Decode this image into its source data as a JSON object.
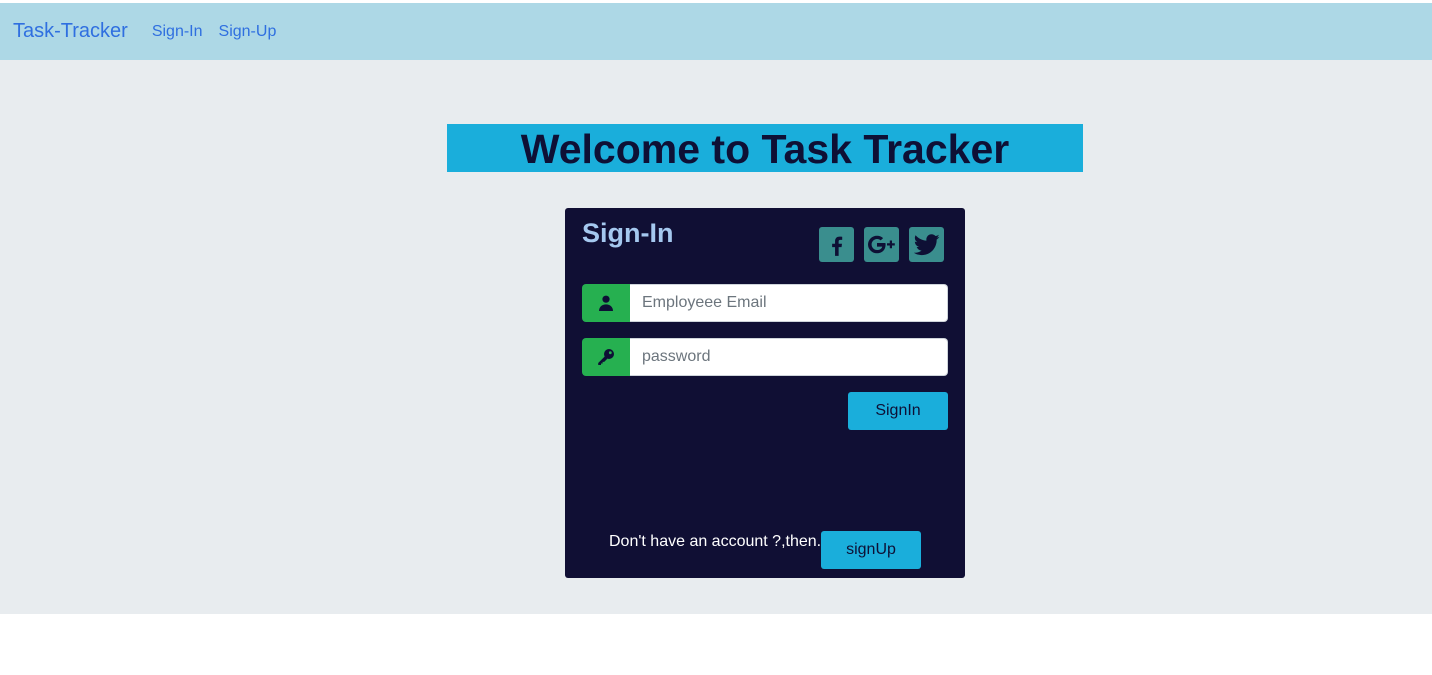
{
  "navbar": {
    "brand": "Task-Tracker",
    "links": [
      "Sign-In",
      "Sign-Up"
    ]
  },
  "welcome": {
    "heading": "Welcome to Task Tracker"
  },
  "signin_card": {
    "title": "Sign-In",
    "social_icons": [
      "facebook-icon",
      "google-plus-icon",
      "twitter-icon"
    ],
    "email_placeholder": "Employeee Email",
    "password_placeholder": "password",
    "submit_label": "SignIn",
    "footer_text": "Don't have an account ?,then..",
    "signup_label": "signUp"
  },
  "colors": {
    "navbar_bg": "#add8e6",
    "link": "#2f6fe0",
    "page_bg": "#e8ecef",
    "accent": "#1aaedb",
    "card_bg": "#100f34",
    "social_bg": "#3a8e8e",
    "addon_green": "#26b050",
    "heading_dark": "#0e1035"
  }
}
